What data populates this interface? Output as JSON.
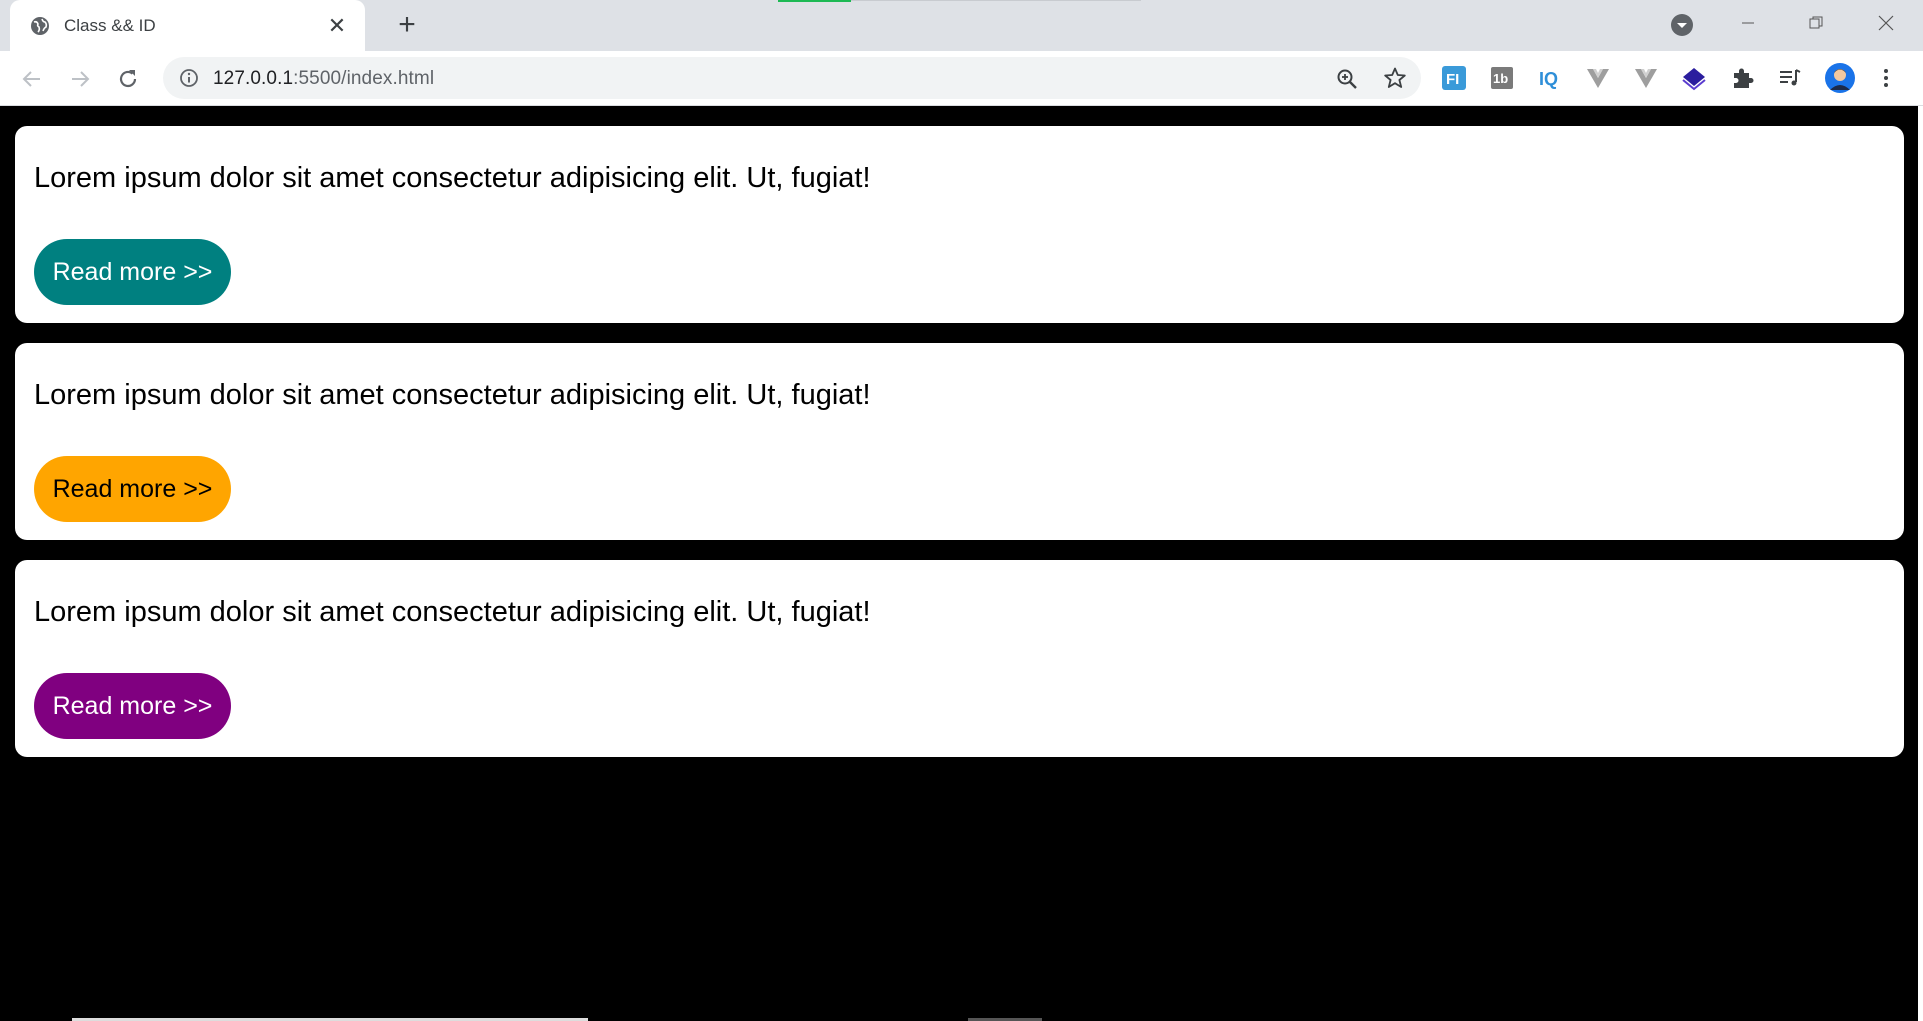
{
  "browser": {
    "tab_title": "Class && ID",
    "url_host": "127.0.0.1",
    "url_path": ":5500/index.html"
  },
  "icons": {
    "tab": "globe-icon",
    "tab_close": "close-icon",
    "new_tab": "plus-icon",
    "back": "arrow-left-icon",
    "forward": "arrow-right-icon",
    "reload": "reload-icon",
    "site_info": "info-icon",
    "zoom": "zoom-icon",
    "bookmark": "star-icon",
    "extensions": [
      "fi-extension-icon",
      "1b-extension-icon",
      "iq-extension-icon",
      "vue-devtools-icon",
      "vue-devtools-icon",
      "stack-extension-icon",
      "puzzle-icon",
      "media-queue-icon"
    ],
    "profile": "avatar",
    "menu": "kebab-menu-icon"
  },
  "cards": [
    {
      "text": "Lorem ipsum dolor sit amet consectetur adipisicing elit. Ut, fugiat!",
      "button_label": "Read more >>",
      "button_color": "#008080",
      "button_text_color": "#ffffff"
    },
    {
      "text": "Lorem ipsum dolor sit amet consectetur adipisicing elit. Ut, fugiat!",
      "button_label": "Read more >>",
      "button_color": "#ffa500",
      "button_text_color": "#000000"
    },
    {
      "text": "Lorem ipsum dolor sit amet consectetur adipisicing elit. Ut, fugiat!",
      "button_label": "Read more >>",
      "button_color": "#800080",
      "button_text_color": "#ffffff"
    }
  ],
  "colors": {
    "page_background": "#000000",
    "card_background": "#ffffff"
  }
}
